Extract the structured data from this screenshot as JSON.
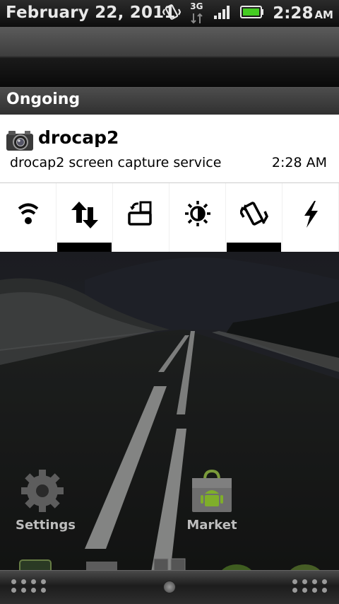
{
  "statusbar": {
    "date": "February 22, 2011",
    "network_label": "3G",
    "time": "2:28",
    "ampm": "AM",
    "icons": [
      "vibrate-icon",
      "network-3g-icon",
      "signal-icon",
      "battery-icon"
    ]
  },
  "section": {
    "title": "Ongoing"
  },
  "notification": {
    "title": "drocap2",
    "description": "drocap2 screen capture service",
    "time": "2:28 AM",
    "icon": "camera-icon"
  },
  "toggles": [
    {
      "name": "wifi",
      "icon": "wifi-icon",
      "active": false
    },
    {
      "name": "mobile-data",
      "icon": "data-arrows-icon",
      "active": true
    },
    {
      "name": "auto-rotate",
      "icon": "rotate-icon",
      "active": false
    },
    {
      "name": "brightness",
      "icon": "brightness-icon",
      "active": false
    },
    {
      "name": "vibrate",
      "icon": "vibrate-icon",
      "active": true
    },
    {
      "name": "flash",
      "icon": "flash-icon",
      "active": false
    }
  ],
  "home": {
    "apps": [
      {
        "label": "Settings",
        "icon": "gear-icon"
      },
      {
        "label": "Market",
        "icon": "market-bag-icon"
      }
    ]
  },
  "colors": {
    "notification_bg": "#ffffff",
    "toggle_active": "#000000",
    "battery": "#44cc22"
  }
}
